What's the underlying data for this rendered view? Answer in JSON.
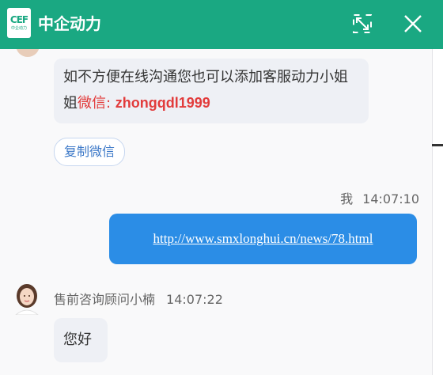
{
  "header": {
    "logo_mark": "CEF",
    "logo_small": "中企动力",
    "title": "中企动力",
    "expand_icon": "expand-icon",
    "close_icon": "close-icon"
  },
  "messages": {
    "first": {
      "text": "如不方便在线沟通您也可以添加客服动力小姐姐",
      "wechat_label": "微信: ",
      "wechat_id": "zhongqdl1999"
    },
    "copy_button": "复制微信",
    "me": {
      "sender": "我",
      "time": "14:07:10",
      "link": "http://www.smxlonghui.cn/news/78.html"
    },
    "agent": {
      "name": "售前咨询顾问小楠",
      "time": "14:07:22",
      "text": "您好"
    }
  },
  "colors": {
    "header": "#1aa882",
    "out_bubble": "#2b8de6",
    "in_bubble": "#eef0f5",
    "wechat_highlight": "#e23b3b",
    "copy_button_text": "#3d79c8"
  }
}
